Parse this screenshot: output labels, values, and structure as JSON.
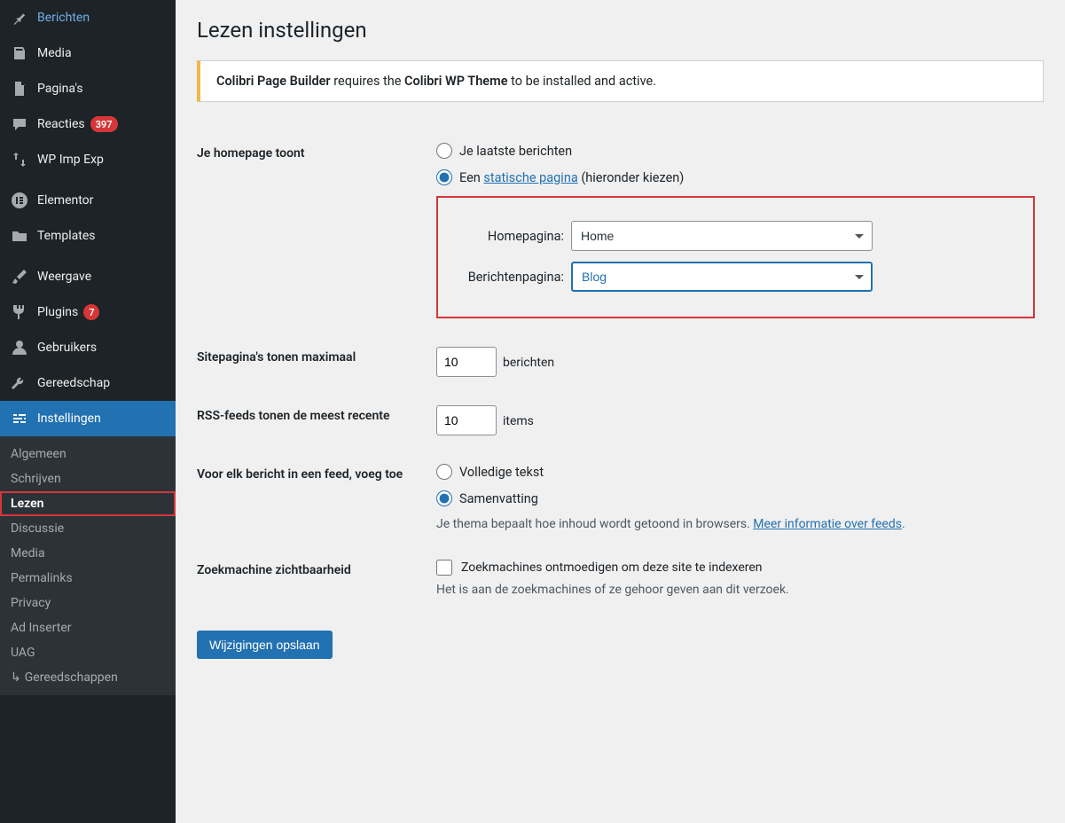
{
  "sidebar": {
    "items": [
      {
        "icon": "pin",
        "label": "Berichten"
      },
      {
        "icon": "media",
        "label": "Media"
      },
      {
        "icon": "page",
        "label": "Pagina's"
      },
      {
        "icon": "comments",
        "label": "Reacties",
        "badge": "397"
      },
      {
        "icon": "impexp",
        "label": "WP Imp Exp"
      }
    ],
    "items2": [
      {
        "icon": "elementor",
        "label": "Elementor"
      },
      {
        "icon": "templates",
        "label": "Templates"
      }
    ],
    "items3": [
      {
        "icon": "appearance",
        "label": "Weergave"
      },
      {
        "icon": "plugins",
        "label": "Plugins",
        "badge": "7"
      },
      {
        "icon": "users",
        "label": "Gebruikers"
      },
      {
        "icon": "tools",
        "label": "Gereedschap"
      },
      {
        "icon": "settings",
        "label": "Instellingen"
      }
    ],
    "submenu": [
      "Algemeen",
      "Schrijven",
      "Lezen",
      "Discussie",
      "Media",
      "Permalinks",
      "Privacy",
      "Ad Inserter",
      "UAG",
      "Gereedschappen"
    ]
  },
  "page": {
    "title": "Lezen instellingen"
  },
  "notice": {
    "strong1": "Colibri Page Builder",
    "mid": " requires the ",
    "strong2": "Colibri WP Theme",
    "tail": " to be installed and active."
  },
  "homepage": {
    "label": "Je homepage toont",
    "opt1": "Je laatste berichten",
    "opt2_pre": "Een ",
    "opt2_link": "statische pagina",
    "opt2_post": " (hieronder kiezen)",
    "homeLabel": "Homepagina:",
    "homeValue": "Home",
    "postsLabel": "Berichtenpagina:",
    "postsValue": "Blog"
  },
  "sitepages": {
    "label": "Sitepagina's tonen maximaal",
    "value": "10",
    "suffix": "berichten"
  },
  "rss": {
    "label": "RSS-feeds tonen de meest recente",
    "value": "10",
    "suffix": "items"
  },
  "feed": {
    "label": "Voor elk bericht in een feed, voeg toe",
    "opt1": "Volledige tekst",
    "opt2": "Samenvatting",
    "desc_pre": "Je thema bepaalt hoe inhoud wordt getoond in browsers. ",
    "desc_link": "Meer informatie over feeds",
    "desc_post": "."
  },
  "seo": {
    "label": "Zoekmachine zichtbaarheid",
    "check": "Zoekmachines ontmoedigen om deze site te indexeren",
    "desc": "Het is aan de zoekmachines of ze gehoor geven aan dit verzoek."
  },
  "save": "Wijzigingen opslaan"
}
